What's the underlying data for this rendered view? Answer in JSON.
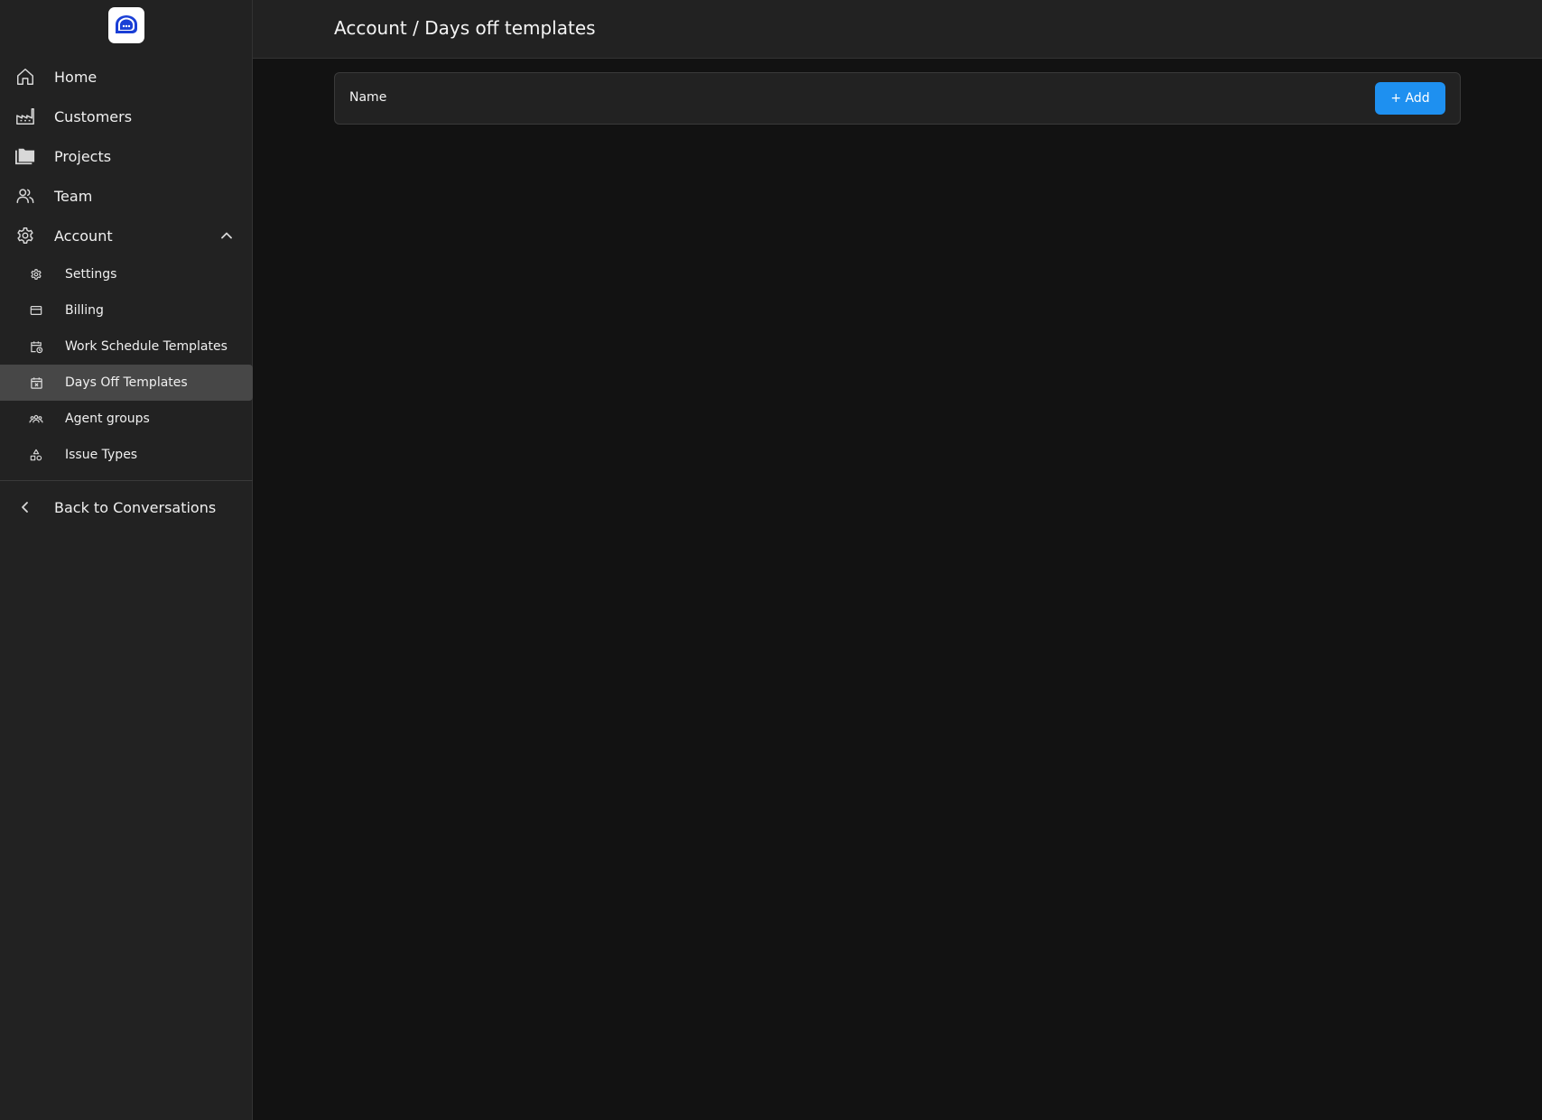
{
  "sidebar": {
    "logo_icon": "chat-bubble-logo-icon",
    "nav": [
      {
        "label": "Home",
        "icon": "home-icon"
      },
      {
        "label": "Customers",
        "icon": "factory-icon"
      },
      {
        "label": "Projects",
        "icon": "folders-icon"
      },
      {
        "label": "Team",
        "icon": "users-icon"
      },
      {
        "label": "Account",
        "icon": "gear-icon",
        "expanded": true
      }
    ],
    "account_sub": [
      {
        "label": "Settings",
        "icon": "gear-small-icon"
      },
      {
        "label": "Billing",
        "icon": "credit-card-icon"
      },
      {
        "label": "Work Schedule Templates",
        "icon": "calendar-clock-icon"
      },
      {
        "label": "Days Off Templates",
        "icon": "calendar-x-icon",
        "active": true
      },
      {
        "label": "Agent groups",
        "icon": "users-group-icon"
      },
      {
        "label": "Issue Types",
        "icon": "shapes-icon"
      }
    ],
    "back_label": "Back to Conversations"
  },
  "header": {
    "title": "Account / Days off templates"
  },
  "table": {
    "columns": [
      "Name"
    ],
    "add_label": "+ Add",
    "rows": []
  },
  "colors": {
    "accent": "#1e90f0",
    "sidebar_bg": "#222222",
    "main_bg": "#121212",
    "active_item_bg": "#474747",
    "logo_blue": "#1a3fd6"
  }
}
